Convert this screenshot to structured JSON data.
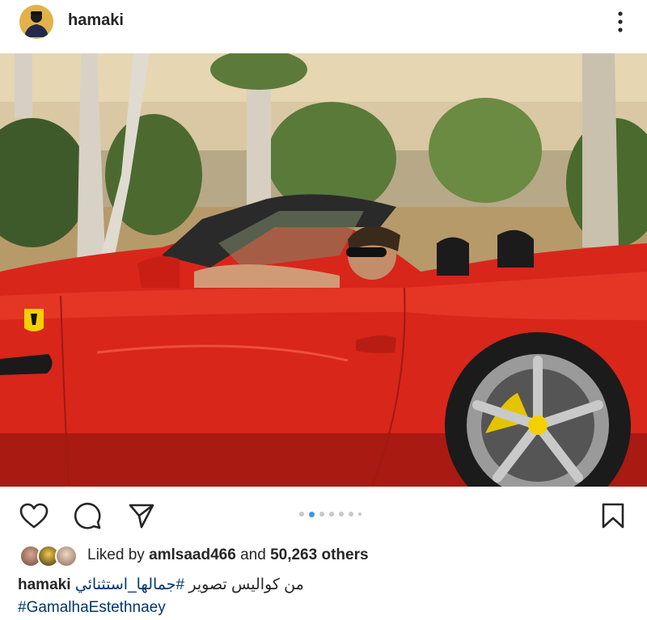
{
  "post": {
    "username": "hamaki",
    "more_icon": "more-vertical-icon",
    "carousel": {
      "count": 7,
      "active_index": 1
    },
    "likes": {
      "prefix": "Liked by",
      "liker": "amlsaad466",
      "conjunction": "and",
      "others": "50,263 others"
    },
    "caption": {
      "username": "hamaki",
      "text": "من كواليس تصوير",
      "hashtag_arabic": "#جمالها_استثنائي",
      "hashtag_latin": "#GamalhaEstethnaey"
    }
  },
  "actions": {
    "like_icon": "heart-icon",
    "comment_icon": "comment-icon",
    "share_icon": "send-icon",
    "save_icon": "bookmark-icon"
  },
  "colors": {
    "link": "#00376b",
    "active_dot": "#3897f0",
    "car_red": "#e3271c"
  }
}
